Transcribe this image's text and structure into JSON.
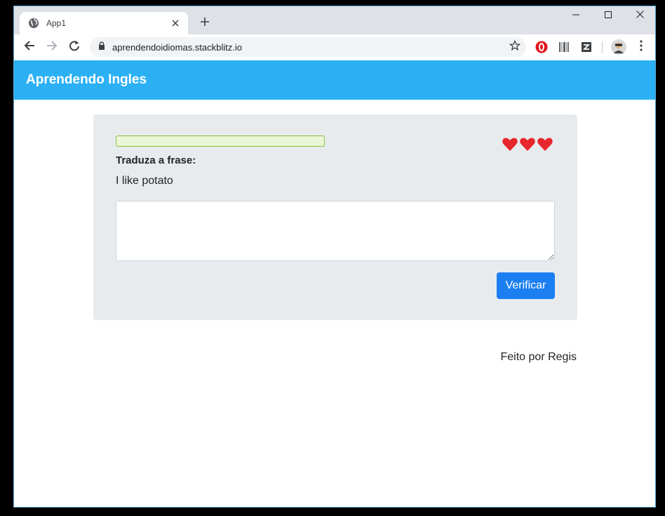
{
  "browser": {
    "tab_title": "App1",
    "url": "aprendendoidiomas.stackblitz.io",
    "icons": {
      "favicon": "globe-icon",
      "tab_close": "close-icon",
      "new_tab": "plus-icon",
      "minimize": "minimize-icon",
      "maximize": "maximize-icon",
      "close_window": "close-icon",
      "back": "arrow-left-icon",
      "forward": "arrow-right-icon",
      "reload": "reload-icon",
      "lock": "lock-icon",
      "bookmark": "star-icon",
      "menu": "kebab-menu-icon"
    },
    "extensions": [
      "opera-ad-blocker-icon",
      "barcode-extension-icon",
      "tag-extension-icon"
    ]
  },
  "app": {
    "brand": "Aprendendo Ingles",
    "progress_fraction": 0,
    "lives": 3,
    "instruction": "Traduza a frase:",
    "phrase": "I like potato",
    "answer_value": "",
    "verify_label": "Verificar",
    "footer": "Feito por Regis"
  },
  "colors": {
    "navbar": "#2bb0f4",
    "card": "#e8ebee",
    "button": "#1b7ff1",
    "heart": "#e8262d",
    "progress_border": "#8bbf3e",
    "progress_bg": "#eaf6d7"
  }
}
